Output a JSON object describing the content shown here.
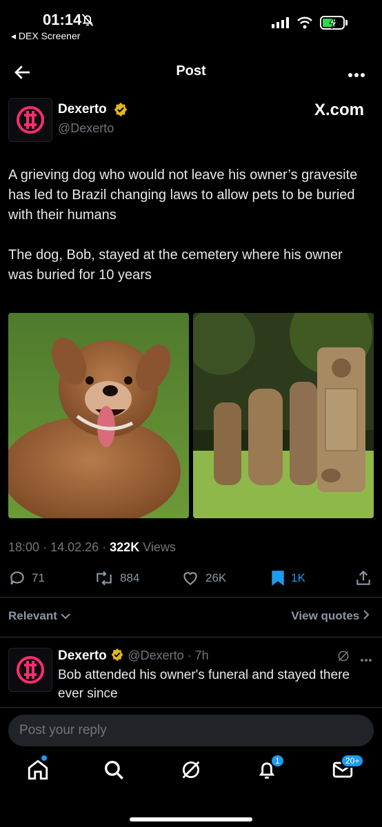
{
  "status": {
    "time": "01:14",
    "back_app": "◂ DEX Screener",
    "icons": [
      "bell-slash-icon",
      "signal-icon",
      "wifi-icon",
      "battery-charging-icon"
    ]
  },
  "header": {
    "title": "Post",
    "icons": [
      "back-arrow-icon",
      "more-icon"
    ]
  },
  "post": {
    "author_name": "Dexerto",
    "author_handle": "@Dexerto",
    "source_label": "X.com",
    "text": "A grieving dog who would not leave his owner’s gravesite has led to Brazil changing laws to allow pets to be buried with their humans\n\nThe dog, Bob, stayed at the cemetery where his owner was buried for 10 years",
    "time": "18:00",
    "date": "14.02.26",
    "views_count": "322K",
    "views_label": "Views",
    "stats": {
      "replies": "71",
      "reposts": "884",
      "likes": "26K",
      "bookmarks": "1K"
    }
  },
  "sort": {
    "label": "Relevant",
    "view_quotes": "View quotes"
  },
  "reply": {
    "author_name": "Dexerto",
    "author_handle": "@Dexerto",
    "age": "7h",
    "text": "Bob attended his owner's funeral and stayed there ever since"
  },
  "composer": {
    "placeholder": "Post your reply"
  },
  "nav": {
    "notifications_badge": "1",
    "messages_badge": "20+"
  },
  "colors": {
    "accent": "#1d9bf0",
    "verified": "#e2b719",
    "background": "#000000",
    "muted": "#71767b"
  }
}
